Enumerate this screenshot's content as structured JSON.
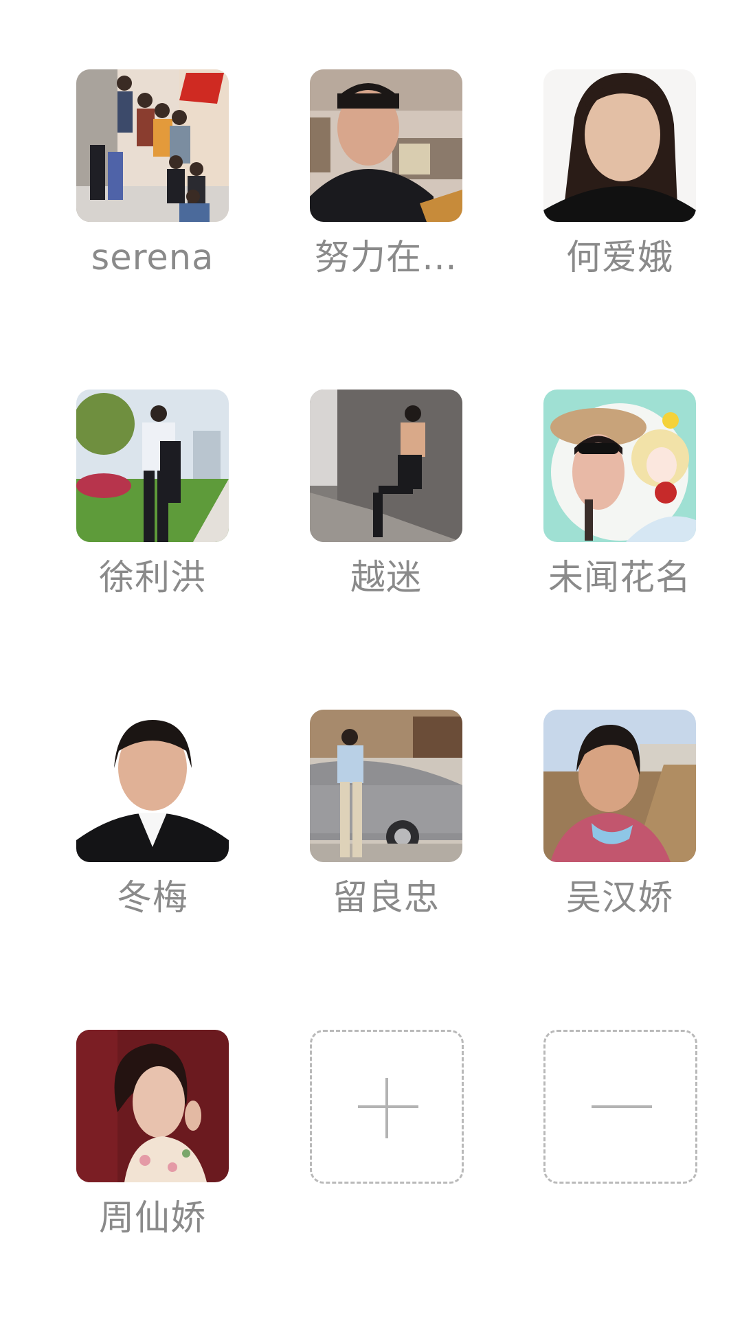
{
  "members": [
    {
      "name": "serena",
      "avatar_icon": "family-photo-avatar"
    },
    {
      "name": "努力在…",
      "avatar_icon": "man-portrait-avatar"
    },
    {
      "name": "何爱娥",
      "avatar_icon": "woman-portrait-avatar"
    },
    {
      "name": "徐利洪",
      "avatar_icon": "man-in-park-avatar"
    },
    {
      "name": "越迷",
      "avatar_icon": "woman-by-wall-avatar"
    },
    {
      "name": "未闻花名",
      "avatar_icon": "woman-with-anime-character-avatar"
    },
    {
      "name": "冬梅",
      "avatar_icon": "woman-id-photo-avatar"
    },
    {
      "name": "留良忠",
      "avatar_icon": "man-with-car-avatar"
    },
    {
      "name": "吴汉娇",
      "avatar_icon": "woman-on-boardwalk-avatar"
    },
    {
      "name": "周仙娇",
      "avatar_icon": "woman-red-background-avatar"
    }
  ],
  "actions": {
    "add_icon": "plus-icon",
    "remove_icon": "minus-icon"
  },
  "colors": {
    "background": "#ffffff",
    "name_text": "#8a8a8a",
    "dashed_border": "#b9b9b9"
  }
}
